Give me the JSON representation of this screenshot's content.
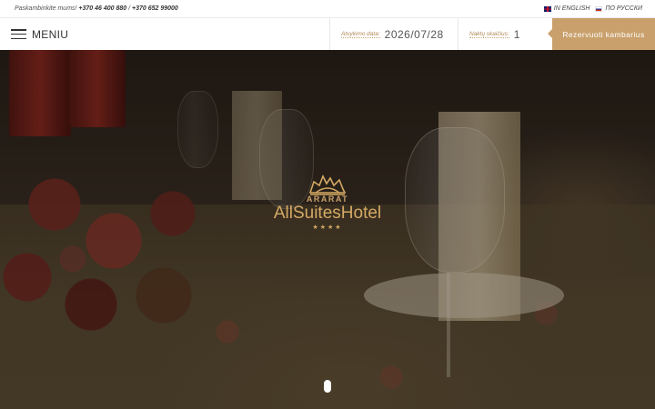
{
  "topbar": {
    "call_prefix": "Paskambinkite mums! ",
    "phone_1": "+370 46 400 880",
    "separator": " / ",
    "phone_2": "+370 652 99000",
    "languages": [
      {
        "label": "IN ENGLISH",
        "flag": "uk-flag-icon"
      },
      {
        "label": "ПО РУССКИ",
        "flag": "ru-flag-icon"
      }
    ]
  },
  "header": {
    "menu_label": "MENIU",
    "arrival_label": "Atvykimo data:",
    "arrival_value": "2026/07/28",
    "nights_label": "Naktų skaičius:",
    "nights_value": "1",
    "reserve_label": "Rezervuoti kambarius"
  },
  "hero": {
    "logo_top": "ARARAT",
    "logo_main": "AllSuitesHotel",
    "logo_stars": "★★★★"
  },
  "colors": {
    "accent": "#c9a06b",
    "logo_gold": "#d4a964"
  }
}
